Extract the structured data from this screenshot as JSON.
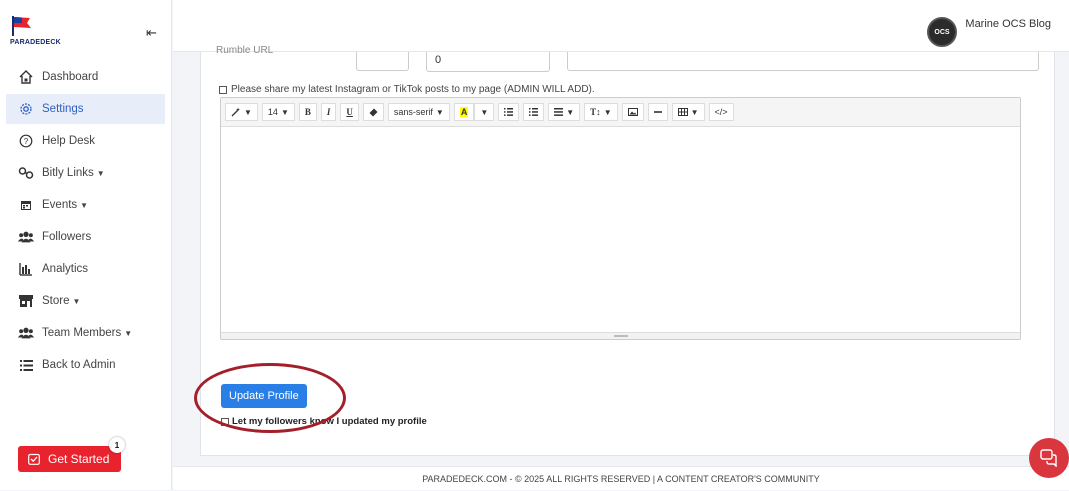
{
  "brand": {
    "name": "PARADEDECK"
  },
  "sidebar": {
    "items": [
      {
        "label": "Dashboard",
        "icon": "home-icon"
      },
      {
        "label": "Settings",
        "icon": "gear-icon",
        "active": true
      },
      {
        "label": "Help Desk",
        "icon": "help-icon"
      },
      {
        "label": "Bitly Links",
        "icon": "link-icon",
        "caret": true
      },
      {
        "label": "Events",
        "icon": "calendar-icon",
        "caret": true
      },
      {
        "label": "Followers",
        "icon": "users-icon"
      },
      {
        "label": "Analytics",
        "icon": "chart-icon"
      },
      {
        "label": "Store",
        "icon": "store-icon",
        "caret": true
      },
      {
        "label": "Team Members",
        "icon": "users-icon",
        "caret": true
      },
      {
        "label": "Back to Admin",
        "icon": "list-icon"
      }
    ],
    "get_started": {
      "label": "Get Started",
      "badge": "1"
    }
  },
  "header": {
    "user_name": "Marine OCS Blog",
    "avatar_text": "OCS"
  },
  "form": {
    "rumble_label": "Rumble URL",
    "count_value": "0",
    "share_label": "Please share my latest Instagram or TikTok posts to my page (ADMIN WILL ADD).",
    "toolbar": {
      "font_size": "14",
      "font_family": "sans-serif"
    },
    "update_button": "Update Profile",
    "notify_label": "Let my followers know I updated my profile"
  },
  "footer": {
    "text": "PARADEDECK.COM - © 2025 ALL RIGHTS RESERVED | A CONTENT CREATOR'S COMMUNITY"
  },
  "colors": {
    "accent": "#2a7fe6",
    "danger": "#e8232e",
    "annotation": "#a3202b"
  }
}
